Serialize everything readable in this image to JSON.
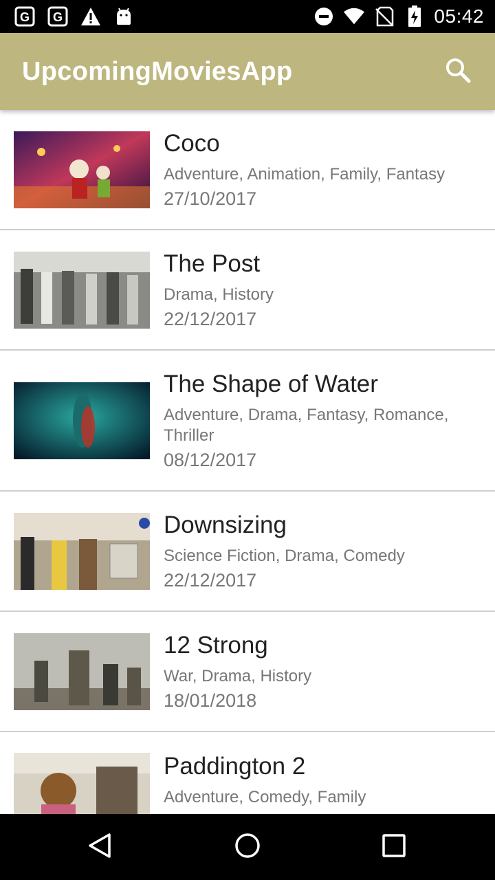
{
  "status_bar": {
    "time": "05:42",
    "left_icons": [
      "g-icon",
      "g-icon",
      "warning-icon",
      "android-icon"
    ],
    "right_icons": [
      "do-not-disturb-icon",
      "wifi-icon",
      "no-sim-icon",
      "battery-charging-icon"
    ]
  },
  "app_bar": {
    "title": "UpcomingMoviesApp",
    "background": "#bdb67e",
    "search_icon": "search-icon"
  },
  "movies": [
    {
      "title": "Coco",
      "genres": "Adventure, Animation, Family, Fantasy",
      "date": "27/10/2017"
    },
    {
      "title": "The Post",
      "genres": "Drama, History",
      "date": "22/12/2017"
    },
    {
      "title": "The Shape of Water",
      "genres": "Adventure, Drama, Fantasy, Romance, Thriller",
      "date": "08/12/2017"
    },
    {
      "title": "Downsizing",
      "genres": "Science Fiction, Drama, Comedy",
      "date": "22/12/2017"
    },
    {
      "title": "12 Strong",
      "genres": "War, Drama, History",
      "date": "18/01/2018"
    },
    {
      "title": "Paddington 2",
      "genres": "Adventure, Comedy, Family",
      "date": ""
    }
  ],
  "nav_bar": {
    "icons": [
      "back-icon",
      "home-icon",
      "recents-icon"
    ]
  }
}
